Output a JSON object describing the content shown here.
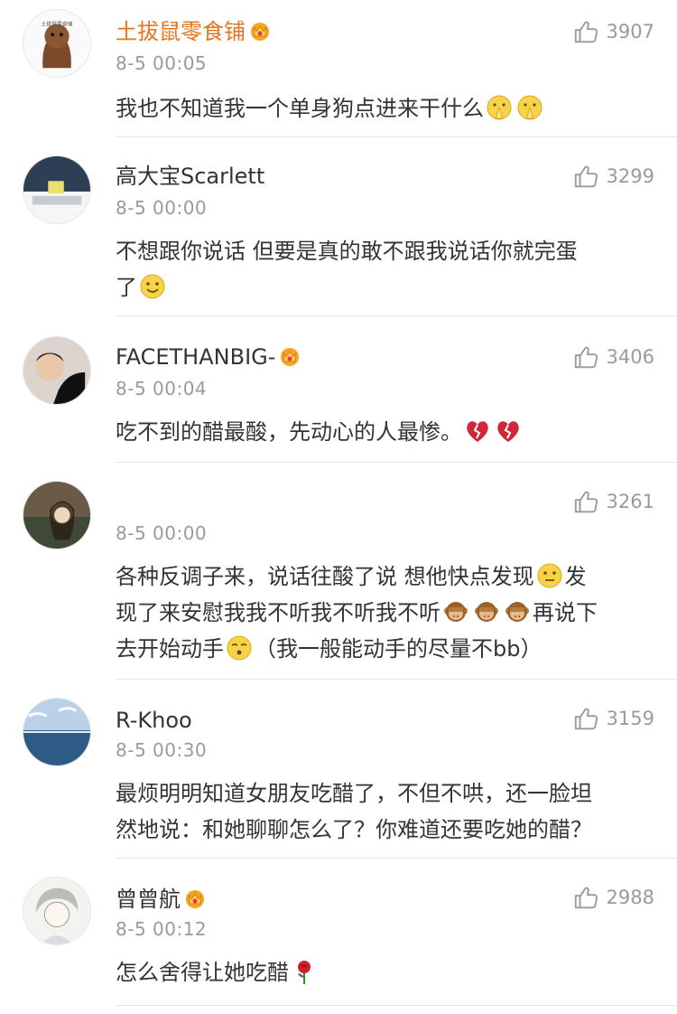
{
  "comments": [
    {
      "user": "土拔鼠零食铺",
      "time": "8-5 00:05",
      "likes": "3907",
      "text": "我也不知道我一个单身狗点进来干什么",
      "text_emojis": [
        "pray-emoji",
        "pray-emoji"
      ]
    },
    {
      "user": "高大宝Scarlett",
      "time": "8-5 00:00",
      "likes": "3299",
      "text_line1": "不想跟你说话 但要是真的敢不跟我说话你就完蛋",
      "text_line2": "了",
      "text_emojis": [
        "smile-emoji"
      ]
    },
    {
      "user": "FACETHANBIG-",
      "time": "8-5 00:04",
      "likes": "3406",
      "text": "吃不到的醋最酸，先动心的人最惨。",
      "text_emojis": [
        "broken-heart-emoji",
        "broken-heart-emoji"
      ]
    },
    {
      "user": "",
      "time": "8-5 00:00",
      "likes": "3261",
      "seg1": "各种反调子来，说话往酸了说 想他快点发现",
      "seg2": "发",
      "seg3": "现了来安慰我我不听我不听我不听",
      "seg4": "再说下",
      "seg5": "去开始动手",
      "seg6": "（我一般能动手的尽量不bb）"
    },
    {
      "user": "R-Khoo",
      "time": "8-5 00:30",
      "likes": "3159",
      "text_line1": "最烦明明知道女朋友吃醋了，不但不哄，还一脸坦",
      "text_line2": "然地说：和她聊聊怎么了？你难道还要吃她的醋？"
    },
    {
      "user": "曾曾航",
      "time": "8-5 00:12",
      "likes": "2988",
      "text": "怎么舍得让她吃醋",
      "text_emojis": [
        "rose-emoji"
      ]
    }
  ],
  "avatar_labels": {
    "c1": "土拔鼠零食铺"
  },
  "colors": {
    "vip_name": "#e8731b",
    "normal_name": "#333333",
    "meta": "#9a9a9a",
    "divider": "#e5e5e5"
  }
}
